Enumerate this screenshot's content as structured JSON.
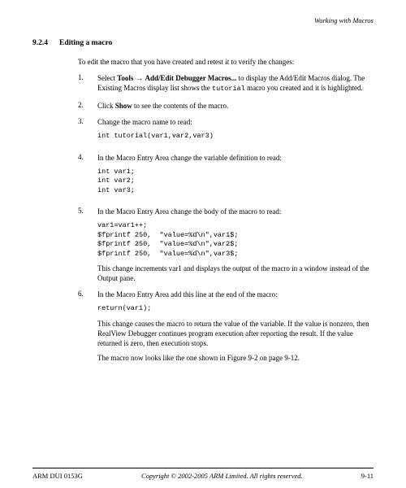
{
  "header": {
    "chapter": "Working with Macros"
  },
  "section": {
    "number": "9.2.4",
    "title": "Editing a macro"
  },
  "intro": "To edit the macro that you have created and retest it to verify the changes:",
  "steps": [
    {
      "num": "1.",
      "lead": "Select ",
      "bold1": "Tools",
      "arrow": " → ",
      "bold2": "Add/Edit Debugger Macros...",
      "tail1": " to display the Add/Edit Macros dialog. The Existing Macros display list shows the ",
      "mono": "tutorial",
      "tail2": " macro you created and it is highlighted."
    },
    {
      "num": "2.",
      "lead": "Click ",
      "bold1": "Show",
      "tail": " to see the contents of the macro."
    },
    {
      "num": "3.",
      "text": "Change the macro name to read:",
      "code": "int tutorial(var1,var2,var3)"
    },
    {
      "num": "4.",
      "text": "In the Macro Entry Area change the variable  definition to read:",
      "code": "int var1;\nint var2;\nint var3;"
    },
    {
      "num": "5.",
      "text": "In the Macro Entry Area change the body of the macro to read:",
      "code": "var1=var1++;\n$fprintf 250,  \"value=%d\\n\",var1$;\n$fprintf 250,  \"value=%d\\n\",var2$;\n$fprintf 250,  \"value=%d\\n\",var3$;",
      "after": "This change increments var1 and displays the output of the macro in a window instead of the Output pane."
    },
    {
      "num": "6.",
      "text": "In the Macro Entry Area add this line at the end of the macro:",
      "code": "return(var1);",
      "after": "This change causes the macro to return the value of the variable. If the value is nonzero, then RealView Debugger continues program execution after reporting the result. If the value returned is zero, then execution stops.",
      "after2": "The macro now looks like the one shown in Figure 9-2 on page 9-12."
    }
  ],
  "footer": {
    "left": "ARM DUI 0153G",
    "center": "Copyright © 2002-2005 ARM Limited. All rights reserved.",
    "right": "9-11"
  }
}
